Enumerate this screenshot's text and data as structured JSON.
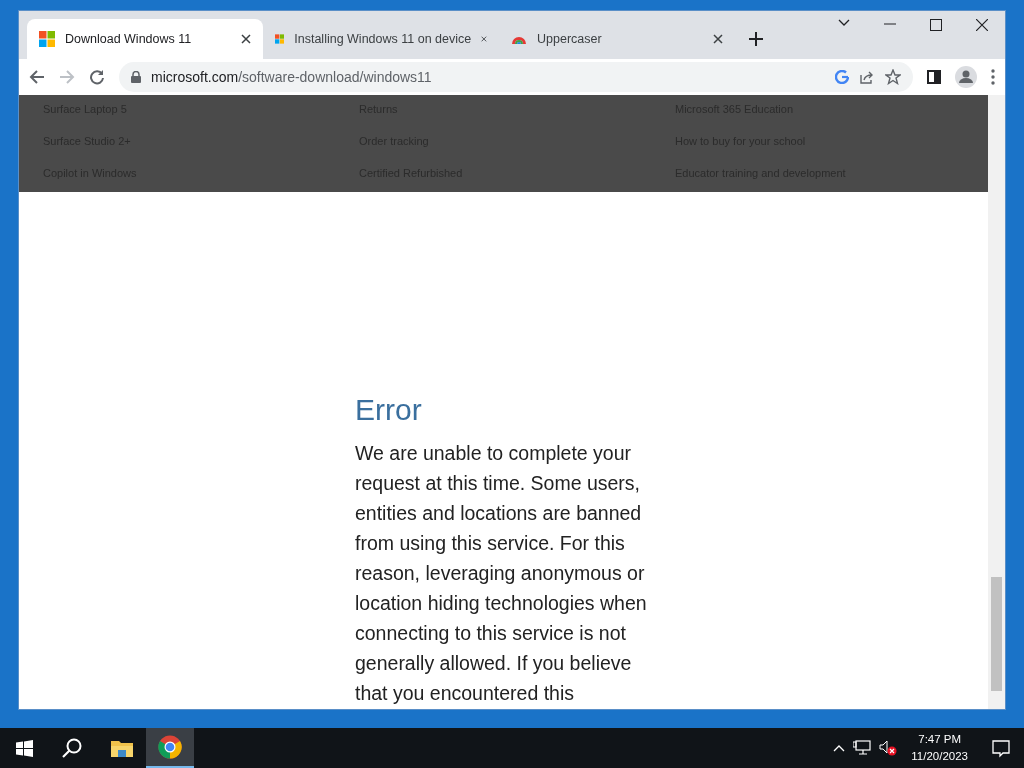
{
  "browser": {
    "tabs": [
      {
        "title": "Download Windows 11",
        "kind": "windows",
        "selected": true
      },
      {
        "title": "Installing Windows 11 on device",
        "kind": "windows",
        "selected": false
      },
      {
        "title": "Uppercaser",
        "kind": "rainbow",
        "selected": false
      }
    ],
    "address": {
      "host": "microsoft.com",
      "path": "/software-download/windows11"
    }
  },
  "footer_columns": [
    [
      "Surface Laptop 5",
      "Surface Studio 2+",
      "Copilot in Windows"
    ],
    [
      "Returns",
      "Order tracking",
      "Certified Refurbished"
    ],
    [
      "Microsoft 365 Education",
      "How to buy for your school",
      "Educator training and development"
    ]
  ],
  "error": {
    "title": "Error",
    "message": "We are unable to complete your request at this time. Some users, entities and locations are banned from using this service. For this reason, leveraging anonymous or location hiding technologies when connecting to this service is not generally allowed. If you believe that you encountered this"
  },
  "taskbar": {
    "apps": [
      {
        "kind": "explorer",
        "selected": false
      },
      {
        "kind": "chrome",
        "selected": true
      }
    ],
    "time": "7:47 PM",
    "date": "11/20/2023"
  }
}
